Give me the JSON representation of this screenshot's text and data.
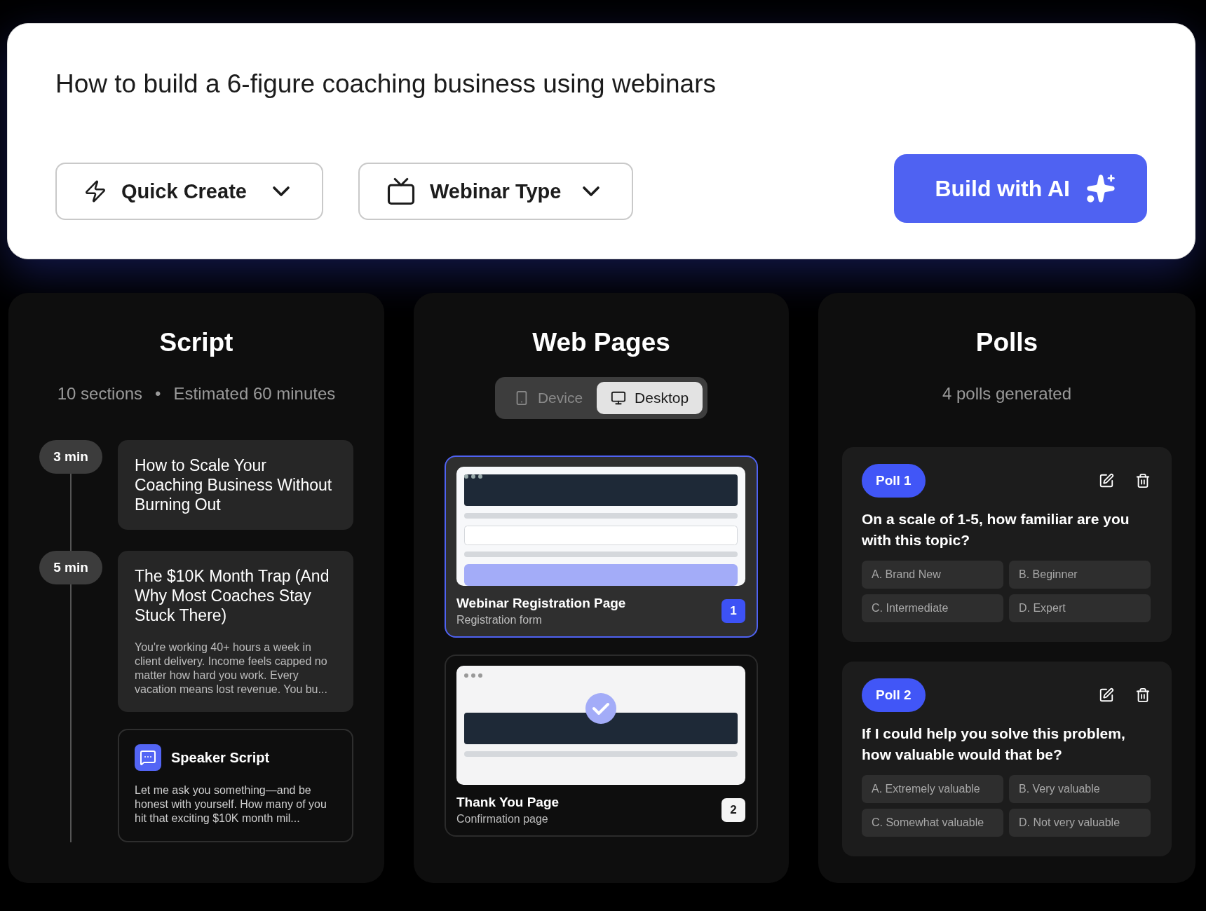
{
  "prompt": {
    "text": "How to build a 6-figure coaching business using webinars"
  },
  "controls": [
    {
      "kind": "mode",
      "label": "Quick Create"
    },
    {
      "kind": "format",
      "label": "Webinar Type"
    },
    {
      "kind": "primary",
      "label": "Build with AI"
    }
  ],
  "script": {
    "title": "Script",
    "sections_count": "10 sections",
    "separator": "•",
    "estimate": "Estimated 60 minutes",
    "sections": [
      {
        "duration": "3 min",
        "title": "How to Scale Your Coaching Business Without Burning Out"
      },
      {
        "duration": "5 min",
        "title": "The $10K Month Trap (And Why Most Coaches Stay Stuck There)",
        "excerpt": "You're working 40+ hours a week in client delivery. Income feels capped no matter how hard you work. Every vacation means lost revenue. You bu...",
        "speaker_script": {
          "title": "Speaker Script",
          "text": "Let me ask you something—and be honest with yourself. How many of you hit that exciting $10K month mil..."
        }
      }
    ]
  },
  "web_pages": {
    "title": "Web Pages",
    "view_toggle": [
      {
        "kind": "device",
        "label": "Device",
        "selected": false
      },
      {
        "kind": "desktop",
        "label": "Desktop",
        "selected": true
      }
    ],
    "pages": [
      {
        "kind": "registration",
        "title": "Webinar Registration Page",
        "subtitle": "Registration form",
        "number": "1",
        "selected": true
      },
      {
        "kind": "confirmation",
        "title": "Thank You Page",
        "subtitle": "Confirmation page",
        "number": "2",
        "selected": false
      }
    ]
  },
  "polls": {
    "title": "Polls",
    "summary": "4 polls generated",
    "items": [
      {
        "label": "Poll 1",
        "question": "On a scale of 1-5, how familiar are you with this topic?",
        "options": [
          "A. Brand New",
          "B. Beginner",
          "C. Intermediate",
          "D. Expert"
        ]
      },
      {
        "label": "Poll 2",
        "question": "If I could help you solve this problem, how valuable would that be?",
        "options": [
          "A. Extremely valuable",
          "B. Very valuable",
          "C. Somewhat valuable",
          "D. Not very valuable"
        ]
      }
    ]
  }
}
